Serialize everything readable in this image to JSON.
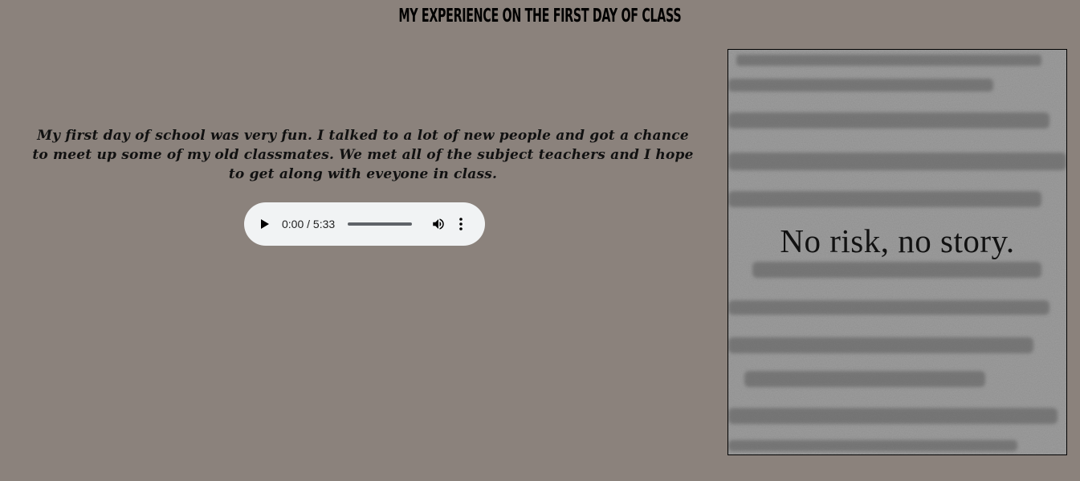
{
  "page": {
    "title": "MY EXPERIENCE ON THE FIRST DAY OF CLASS",
    "background_color": "#8b827c"
  },
  "story": {
    "text": "My first day of school was very fun. I talked to a lot of new people and got a chance to meet up some of my old classmates. We met all of the subject teachers and I hope to get along with eveyone in class."
  },
  "audio": {
    "time_display": "0:00 / 5:33",
    "current_time": "0:00",
    "duration": "5:33",
    "progress": 0,
    "play_icon": "play-icon",
    "volume_icon": "volume-icon",
    "menu_icon": "more-vert-icon"
  },
  "image": {
    "caption": "No risk, no story."
  }
}
